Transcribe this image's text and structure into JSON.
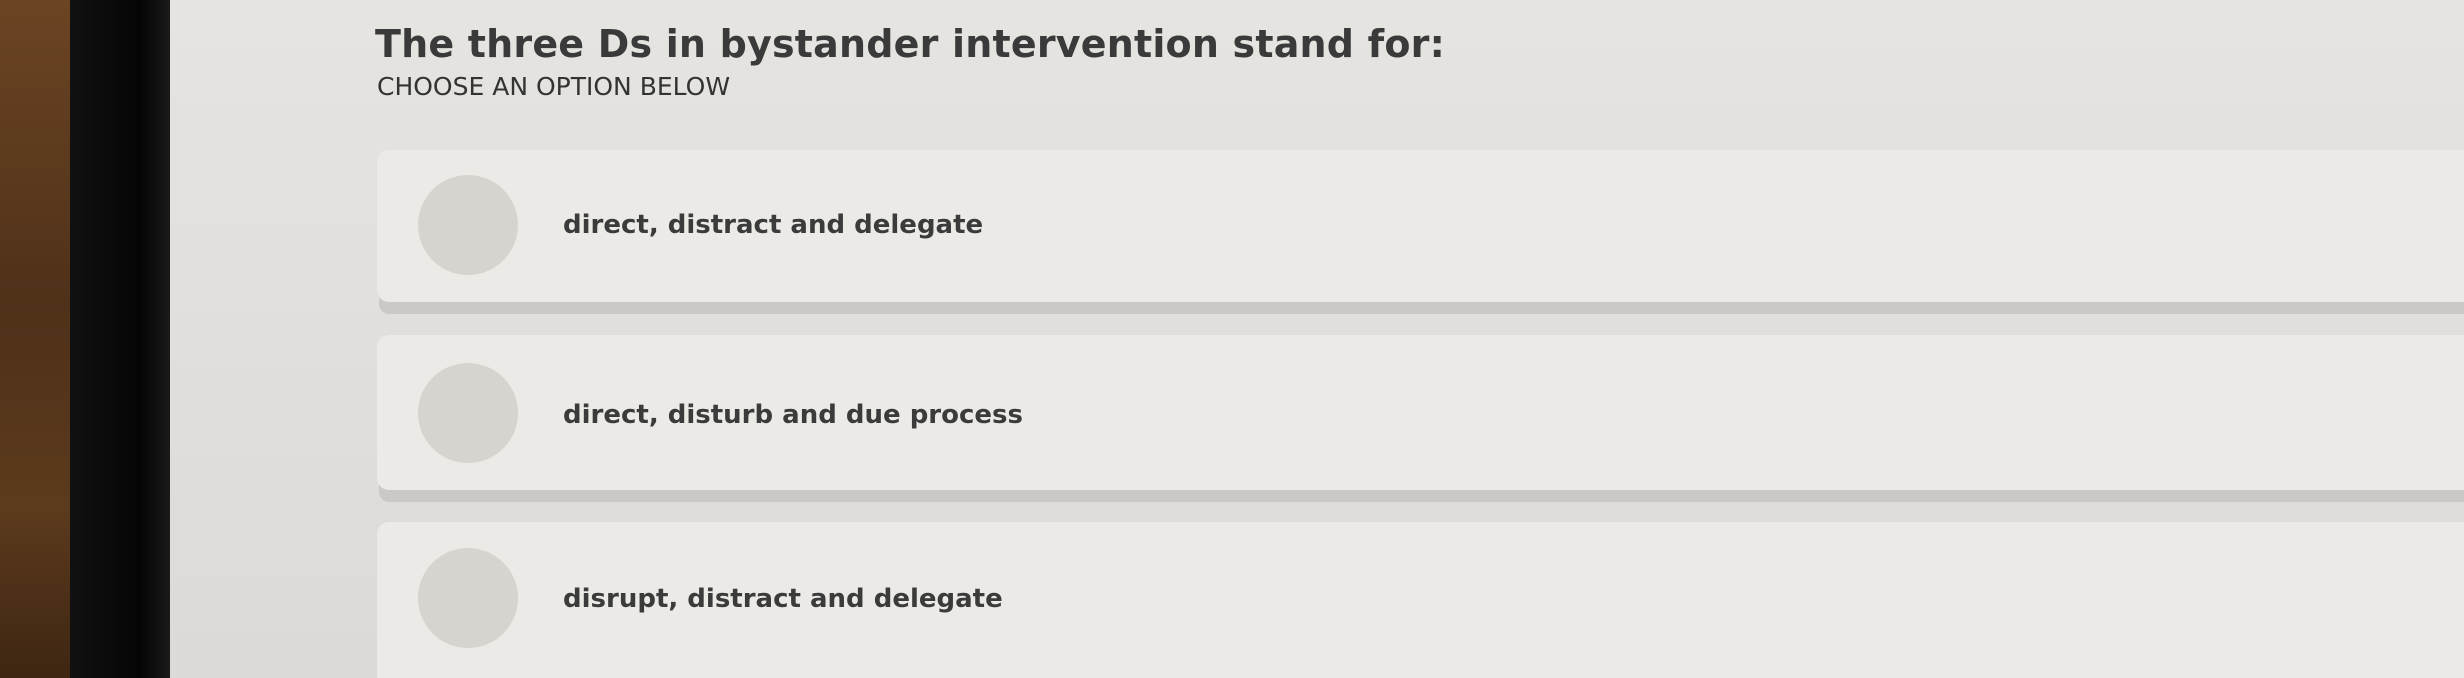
{
  "question": {
    "title": "The three Ds in bystander intervention stand for:",
    "instruction": "CHOOSE AN OPTION BELOW"
  },
  "options": [
    {
      "label": "direct, distract and delegate",
      "selected": false
    },
    {
      "label": "direct, disturb and due process",
      "selected": false
    },
    {
      "label": "disrupt, distract and delegate",
      "selected": false
    }
  ],
  "colors": {
    "screen_background": "#e2e0dc",
    "card_background": "#eceae6",
    "radio_fill": "#d7d3ce",
    "text": "#3a3a3a"
  }
}
